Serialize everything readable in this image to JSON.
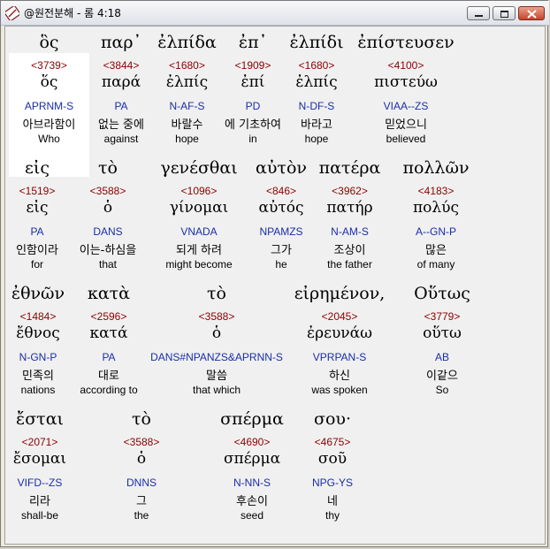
{
  "window": {
    "title": "@원전분해 - 롬 4:18",
    "app_icon": "bible-book-icon",
    "controls": {
      "minimize": "minimize-icon",
      "maximize": "maximize-icon",
      "close": "close-icon"
    }
  },
  "words": [
    {
      "gk": "ὃς",
      "sn": "<3739>",
      "lm": "ὅς",
      "mp": "APRNM-S",
      "kr": "아브라함이",
      "en": "Who"
    },
    {
      "gk": "παρ᾽",
      "sn": "<3844>",
      "lm": "παρά",
      "mp": "PA",
      "kr": "없는 중에",
      "en": "against"
    },
    {
      "gk": "ἐλπίδα",
      "sn": "<1680>",
      "lm": "ἐλπίς",
      "mp": "N-AF-S",
      "kr": "바랄수",
      "en": "hope"
    },
    {
      "gk": "ἐπ᾽",
      "sn": "<1909>",
      "lm": "ἐπί",
      "mp": "PD",
      "kr": "에 기초하여",
      "en": "in"
    },
    {
      "gk": "ἐλπίδι",
      "sn": "<1680>",
      "lm": "ἐλπίς",
      "mp": "N-DF-S",
      "kr": "바라고",
      "en": "hope"
    },
    {
      "gk": "ἐπίστευσεν",
      "sn": "<4100>",
      "lm": "πιστεύω",
      "mp": "VIAA--ZS",
      "kr": "믿었으니",
      "en": "believed"
    },
    {
      "gk": "εἰς",
      "sn": "<1519>",
      "lm": "εἰς",
      "mp": "PA",
      "kr": "인함이라",
      "en": "for"
    },
    {
      "gk": "τὸ",
      "sn": "<3588>",
      "lm": "ὁ",
      "mp": "DANS",
      "kr": "이는-하심을",
      "en": "that"
    },
    {
      "gk": "γενέσθαι",
      "sn": "<1096>",
      "lm": "γίνομαι",
      "mp": "VNADA",
      "kr": "되게 하려",
      "en": "might become"
    },
    {
      "gk": "αὐτὸν",
      "sn": "<846>",
      "lm": "αὐτός",
      "mp": "NPAMZS",
      "kr": "그가",
      "en": "he"
    },
    {
      "gk": "πατέρα",
      "sn": "<3962>",
      "lm": "πατήρ",
      "mp": "N-AM-S",
      "kr": "조상이",
      "en": "the father"
    },
    {
      "gk": "πολλῶν",
      "sn": "<4183>",
      "lm": "πολύς",
      "mp": "A--GN-P",
      "kr": "많은",
      "en": "of many"
    },
    {
      "gk": "ἐθνῶν",
      "sn": "<1484>",
      "lm": "ἔθνος",
      "mp": "N-GN-P",
      "kr": "민족의",
      "en": "nations"
    },
    {
      "gk": "κατὰ",
      "sn": "<2596>",
      "lm": "κατά",
      "mp": "PA",
      "kr": "대로",
      "en": "according to"
    },
    {
      "gk": "τὸ",
      "sn": "<3588>",
      "lm": "ὁ",
      "mp": "DANS#NPANZS&APRNN-S",
      "kr": "말씀",
      "en": "that which"
    },
    {
      "gk": "εἰρημένον,",
      "sn": "<2045>",
      "lm": "ἐρευνάω",
      "mp": "VPRPAN-S",
      "kr": "하신",
      "en": "was spoken"
    },
    {
      "gk": "Οὕτως",
      "sn": "<3779>",
      "lm": "οὕτω",
      "mp": "AB",
      "kr": "이같으",
      "en": "So"
    },
    {
      "gk": "ἔσται",
      "sn": "<2071>",
      "lm": "ἔσομαι",
      "mp": "VIFD--ZS",
      "kr": "리라",
      "en": "shall-be"
    },
    {
      "gk": "τὸ",
      "sn": "<3588>",
      "lm": "ὁ",
      "mp": "DNNS",
      "kr": "그",
      "en": "the"
    },
    {
      "gk": "σπέρμα",
      "sn": "<4690>",
      "lm": "σπέρμα",
      "mp": "N-NN-S",
      "kr": "후손이",
      "en": "seed"
    },
    {
      "gk": "σου·",
      "sn": "<4675>",
      "lm": "σοῦ",
      "mp": "NPG-YS",
      "kr": "네",
      "en": "thy"
    }
  ]
}
